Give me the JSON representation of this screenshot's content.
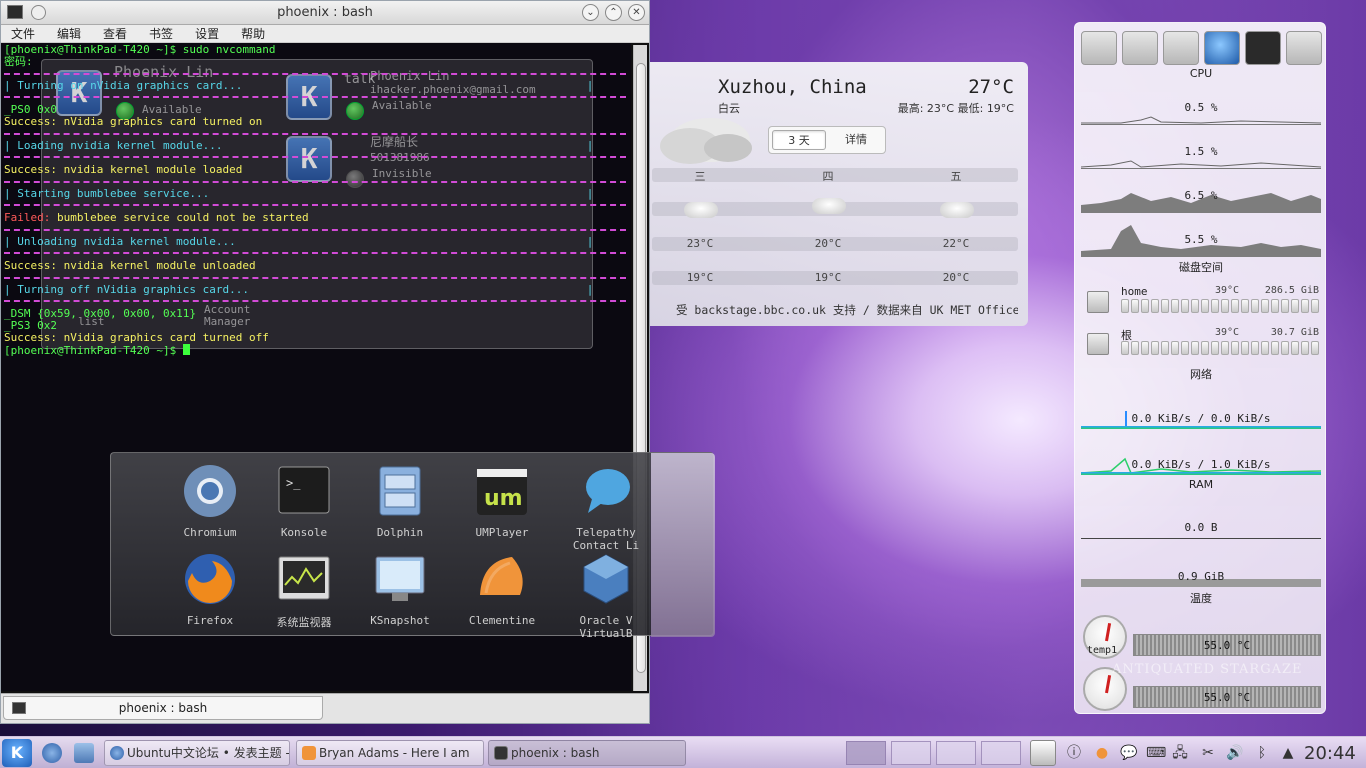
{
  "terminal": {
    "title": "phoenix : bash",
    "menu": [
      "文件",
      "编辑",
      "查看",
      "书签",
      "设置",
      "帮助"
    ],
    "lines": [
      {
        "text": "[phoenix@ThinkPad-T420 ~]$ sudo nvcommand",
        "cls": "c-green"
      },
      {
        "text": "密码:",
        "cls": "c-green"
      },
      {
        "text": "| Turning on nVidia graphics card...                                                    |",
        "cls": "c-cyan"
      },
      {
        "text": "_PS0 0x0",
        "cls": "c-green"
      },
      {
        "text": "Success: nVidia graphics card turned on",
        "cls": "c-yellow"
      },
      {
        "text": "| Loading nvidia kernel module...                                                       |",
        "cls": "c-cyan"
      },
      {
        "text": "Success: nvidia kernel module loaded",
        "cls": "c-yellow"
      },
      {
        "text": "| Starting bumblebee service...                                                         |",
        "cls": "c-cyan"
      },
      {
        "text": "bumblebee service could not be started",
        "cls": "c-yellow",
        "prefix": "Failed:",
        "prefix_cls": "c-red"
      },
      {
        "text": "| Unloading nvidia kernel module...                                                     |",
        "cls": "c-cyan"
      },
      {
        "text": "Success: nvidia kernel module unloaded",
        "cls": "c-yellow"
      },
      {
        "text": "| Turning off nVidia graphics card...                                                   |",
        "cls": "c-cyan"
      },
      {
        "text": "_DSM {0x59, 0x00, 0x00, 0x11}",
        "cls": "c-green"
      },
      {
        "text": "_PS3 0x2",
        "cls": "c-green"
      },
      {
        "text": "Success: nVidia graphics card turned off",
        "cls": "c-yellow"
      },
      {
        "text": "[phoenix@ThinkPad-T420 ~]$ ",
        "cls": "c-green"
      }
    ],
    "tab_label": "phoenix : bash"
  },
  "contacts": {
    "me_name": "Phoenix Lin",
    "me_status": "Available",
    "contact_name": "Phoenix Lin",
    "contact_email": "ihacker.phoenix@gmail.com",
    "contact_status": "Available",
    "contact2_name": "尼摩船长",
    "contact2_id": "501381986",
    "contact2_status": "Invisible",
    "talk_label": "talk",
    "list_label": "list",
    "account_manager_label": "Account Manager"
  },
  "launcher": {
    "apps": [
      {
        "label": "Chromium",
        "icon": "chromium-icon"
      },
      {
        "label": "Konsole",
        "icon": "konsole-icon"
      },
      {
        "label": "Dolphin",
        "icon": "dolphin-icon"
      },
      {
        "label": "UMPlayer",
        "icon": "umplayer-icon"
      },
      {
        "label": "Telepathy Contact Li",
        "icon": "telepathy-icon"
      },
      {
        "label": "Firefox",
        "icon": "firefox-icon"
      },
      {
        "label": "系统监视器",
        "icon": "system-monitor-icon"
      },
      {
        "label": "KSnapshot",
        "icon": "ksnapshot-icon"
      },
      {
        "label": "Clementine",
        "icon": "clementine-icon"
      },
      {
        "label": "Oracle V VirtualB",
        "icon": "virtualbox-icon"
      }
    ]
  },
  "weather": {
    "city": "Xuzhou, China",
    "temp": "27°C",
    "condition": "白云",
    "hilo": "最高: 23°C 最低: 19°C",
    "tabs": [
      "3 天",
      "详情"
    ],
    "days": [
      "三",
      "四",
      "五"
    ],
    "highs": [
      "23°C",
      "20°C",
      "22°C"
    ],
    "lows": [
      "19°C",
      "19°C",
      "20°C"
    ],
    "credit": "受 backstage.bbc.co.uk 支持 / 数据来自 UK MET Office"
  },
  "sysmon": {
    "cpu_label": "CPU",
    "cpu_values": [
      "0.5 %",
      "1.5 %",
      "6.5 %",
      "5.5 %"
    ],
    "disk_label": "磁盘空间",
    "disks": [
      {
        "name": "home",
        "temp": "39°C",
        "size": "286.5 GiB"
      },
      {
        "name": "根",
        "temp": "39°C",
        "size": "30.7 GiB"
      }
    ],
    "net_label": "网络",
    "net_values": [
      "0.0 KiB/s / 0.0 KiB/s",
      "0.0 KiB/s / 1.0 KiB/s"
    ],
    "ram_label": "RAM",
    "ram_values": [
      "0.0 B",
      "0.9 GiB"
    ],
    "temp_label": "温度",
    "temps": [
      {
        "name": "temp1",
        "value": "55.0 °C"
      },
      {
        "name": "",
        "value": "55.0 °C"
      }
    ]
  },
  "wallpaper_text": "ANTIQUATED STARGAZE",
  "taskbar": {
    "tasks": [
      {
        "label": "Ubuntu中文论坛 • 发表主题 -"
      },
      {
        "label": "Bryan Adams - Here I am"
      },
      {
        "label": "phoenix : bash"
      }
    ],
    "clock": "20:44"
  }
}
